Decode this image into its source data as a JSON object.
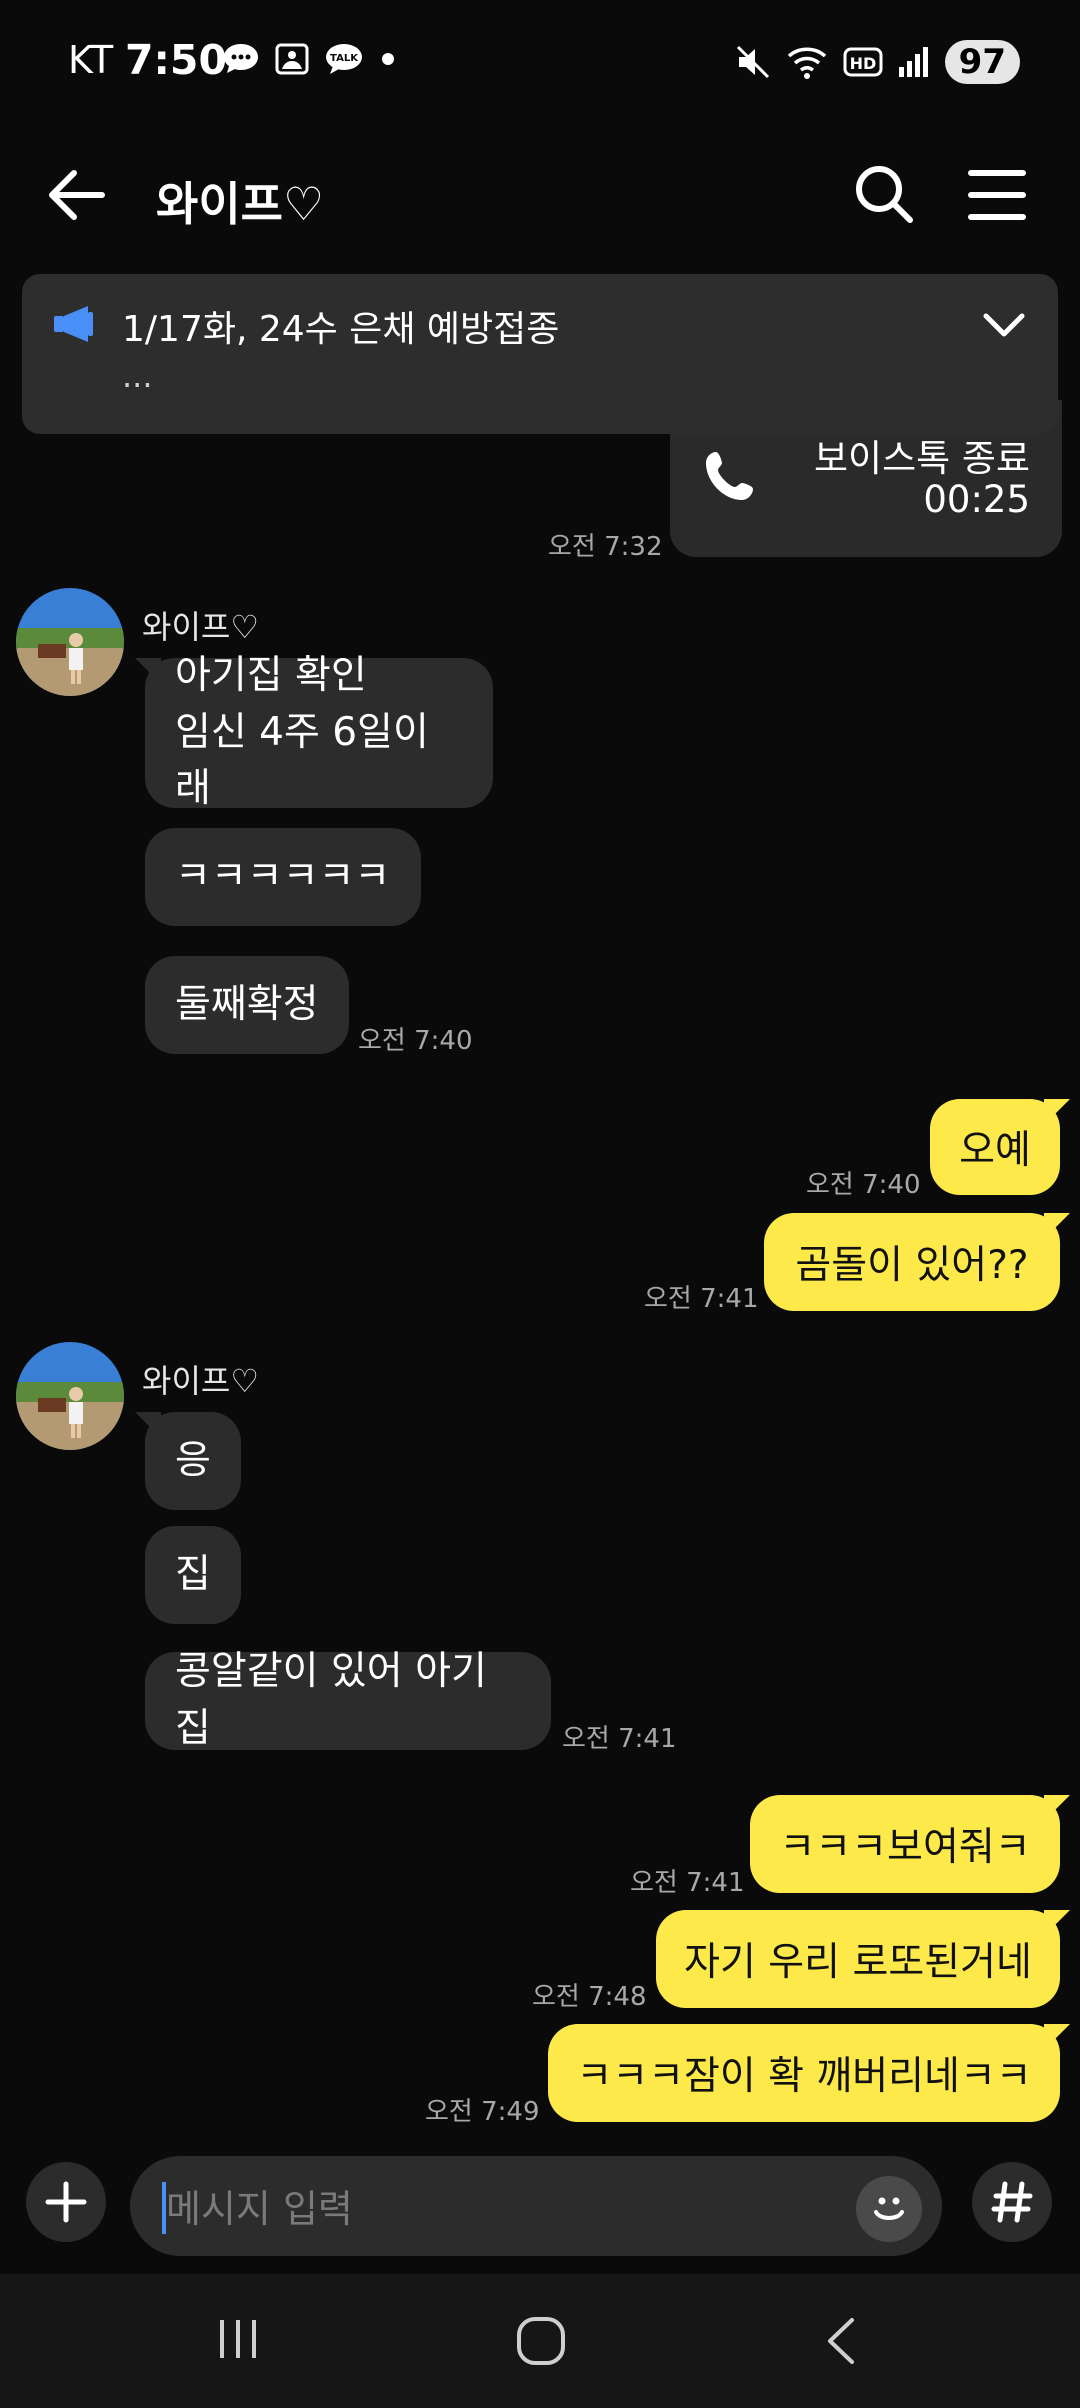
{
  "status_bar": {
    "carrier": "KT",
    "time": "7:50",
    "battery": "97"
  },
  "header": {
    "title": "와이프♡"
  },
  "notice": {
    "text": "1/17화, 24수 은채 예방접종",
    "ellipsis": "..."
  },
  "call": {
    "label": "보이스톡 종료",
    "duration": "00:25",
    "time": "오전 7:32"
  },
  "groups": [
    {
      "sender": "와이프♡",
      "messages": [
        "아기집 확인\n임신 4주 6일이래",
        "ㅋㅋㅋㅋㅋㅋ",
        "둘째확정"
      ],
      "time": "오전 7:40"
    },
    {
      "sender": "와이프♡",
      "messages": [
        "응",
        "집",
        "콩알같이 있어 아기집"
      ],
      "time": "오전 7:41"
    }
  ],
  "outgoing": [
    {
      "text": "오예",
      "time": "오전 7:40"
    },
    {
      "text": "곰돌이 있어??",
      "time": "오전 7:41"
    },
    {
      "text": "ㅋㅋㅋ보여줘ㅋ",
      "time": "오전 7:41"
    },
    {
      "text": "자기 우리 로또된거네",
      "time": "오전 7:48"
    },
    {
      "text": "ㅋㅋㅋ잠이 확 깨버리네ㅋㅋ",
      "time": "오전 7:49"
    }
  ],
  "input": {
    "placeholder": "메시지 입력"
  },
  "colors": {
    "background": "#0a0a0a",
    "incoming_bubble": "#2c2c2c",
    "outgoing_bubble": "#fde94a",
    "accent_blue": "#4a8ef7"
  },
  "icons": [
    "back-arrow-icon",
    "search-icon",
    "menu-icon",
    "megaphone-icon",
    "chevron-down-icon",
    "phone-icon",
    "plus-icon",
    "emoji-icon",
    "hash-icon"
  ]
}
